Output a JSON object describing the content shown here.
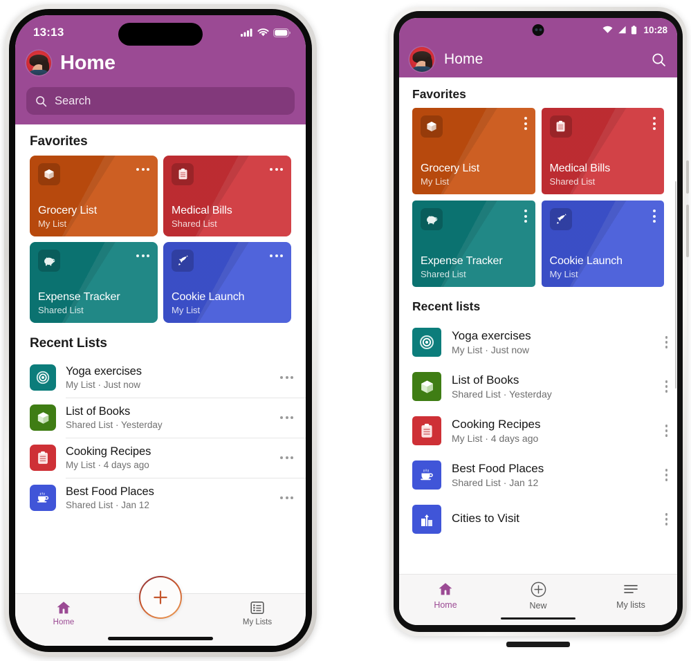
{
  "theme": {
    "brand_purple": "#9B4A94",
    "orange": "#C8500E",
    "red": "#CE3036",
    "teal": "#0C7D7B",
    "blue": "#4055D8",
    "green": "#3F7D14",
    "muted_text": "#707070"
  },
  "iphone": {
    "status": {
      "time": "13:13",
      "cellular": "signal-bars",
      "wifi": "wifi",
      "battery": "battery-full"
    },
    "header": {
      "title": "Home",
      "avatar_label": "profile-photo"
    },
    "search": {
      "placeholder": "Search",
      "icon": "search-icon"
    },
    "favorites": {
      "section_title": "Favorites",
      "cards": [
        {
          "name": "Grocery List",
          "sub": "My List",
          "color": "#C8500E",
          "icon": "box-icon"
        },
        {
          "name": "Medical Bills",
          "sub": "Shared List",
          "color": "#CE3036",
          "icon": "clipboard-icon"
        },
        {
          "name": "Expense Tracker",
          "sub": "Shared List",
          "color": "#0C7D7B",
          "icon": "piggy-bank-icon"
        },
        {
          "name": "Cookie Launch",
          "sub": "My List",
          "color": "#4055D8",
          "icon": "rocket-icon"
        }
      ]
    },
    "recent": {
      "section_title": "Recent Lists",
      "items": [
        {
          "name": "Yoga exercises",
          "sub": "My List · Just now",
          "color": "#0C7D7B",
          "icon": "target-icon"
        },
        {
          "name": "List of Books",
          "sub": "Shared List · Yesterday",
          "color": "#3F7D14",
          "icon": "box-icon"
        },
        {
          "name": "Cooking Recipes",
          "sub": "My List · 4 days ago",
          "color": "#CE3036",
          "icon": "clipboard-icon"
        },
        {
          "name": "Best Food Places",
          "sub": "Shared List · Jan 12",
          "color": "#4055D8",
          "icon": "coffee-cup-icon"
        }
      ]
    },
    "tabbar": {
      "home_label": "Home",
      "add_label": "add-button",
      "mylists_label": "My Lists"
    }
  },
  "android": {
    "status": {
      "time": "10:28",
      "wifi": "wifi",
      "cellular": "signal-triangle",
      "battery": "battery-full"
    },
    "header": {
      "title": "Home",
      "avatar_label": "profile-photo",
      "search_icon": "search-icon"
    },
    "favorites": {
      "section_title": "Favorites",
      "cards": [
        {
          "name": "Grocery List",
          "sub": "My List",
          "color": "#C8500E",
          "icon": "box-icon"
        },
        {
          "name": "Medical Bills",
          "sub": "Shared List",
          "color": "#CE3036",
          "icon": "clipboard-icon"
        },
        {
          "name": "Expense Tracker",
          "sub": "Shared List",
          "color": "#0C7D7B",
          "icon": "piggy-bank-icon"
        },
        {
          "name": "Cookie Launch",
          "sub": "My List",
          "color": "#4055D8",
          "icon": "rocket-icon"
        }
      ]
    },
    "recent": {
      "section_title": "Recent lists",
      "items": [
        {
          "name": "Yoga exercises",
          "sub": "My List · Just now",
          "color": "#0C7D7B",
          "icon": "target-icon"
        },
        {
          "name": "List of Books",
          "sub": "Shared List · Yesterday",
          "color": "#3F7D14",
          "icon": "box-icon"
        },
        {
          "name": "Cooking Recipes",
          "sub": "My List · 4 days ago",
          "color": "#CE3036",
          "icon": "clipboard-icon"
        },
        {
          "name": "Best Food Places",
          "sub": "Shared List · Jan 12",
          "color": "#4055D8",
          "icon": "coffee-cup-icon"
        },
        {
          "name": "Cities to Visit",
          "sub": "",
          "color": "#4055D8",
          "icon": "city-icon"
        }
      ]
    },
    "navbar": {
      "home_label": "Home",
      "new_label": "New",
      "mylists_label": "My lists"
    }
  }
}
